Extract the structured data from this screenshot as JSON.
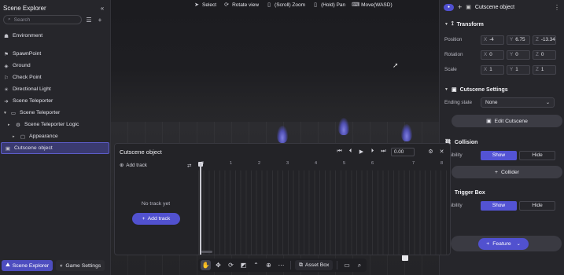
{
  "toolbar_hints": [
    {
      "icon": "cursor-icon",
      "label": "Select"
    },
    {
      "icon": "rotate-icon",
      "label": "Rotate view"
    },
    {
      "icon": "mouse-scroll-icon",
      "label": "(Scroll) Zoom"
    },
    {
      "icon": "mouse-hold-icon",
      "label": "(Hold) Pan"
    },
    {
      "icon": "wasd-icon",
      "label": "Move(WASD)"
    }
  ],
  "scene_explorer": {
    "title": "Scene Explorer",
    "search_placeholder": "Search",
    "items": [
      {
        "label": "Environment",
        "icon": "environment-icon",
        "indent": 0,
        "caret": false
      },
      {
        "label": "SpawnPoint",
        "icon": "spawn-icon",
        "indent": 0,
        "caret": false
      },
      {
        "label": "Ground",
        "icon": "ground-icon",
        "indent": 0,
        "caret": false
      },
      {
        "label": "Check Point",
        "icon": "checkpoint-icon",
        "indent": 0,
        "caret": false
      },
      {
        "label": "Directional Light",
        "icon": "light-icon",
        "indent": 0,
        "caret": false
      },
      {
        "label": "Scene Teleporter",
        "icon": "teleporter-icon",
        "indent": 0,
        "caret": false
      },
      {
        "label": "Scene Teleporter",
        "icon": "folder-icon",
        "indent": 0,
        "caret": true
      },
      {
        "label": "Scene Teleporter Logic",
        "icon": "logic-icon",
        "indent": 1,
        "caret": true
      },
      {
        "label": "Appearance",
        "icon": "appearance-icon",
        "indent": 2,
        "caret": true
      },
      {
        "label": "Cutscene object",
        "icon": "cutscene-icon",
        "indent": 0,
        "caret": false,
        "selected": true
      }
    ]
  },
  "bottom_left": {
    "scene_explorer_label": "Scene Explorer",
    "game_settings_label": "Game Settings"
  },
  "bottom_toolbar": {
    "asset_box_label": "Asset Box"
  },
  "inspector": {
    "object_name": "Cutscene object",
    "transform": {
      "title": "Transform",
      "position_label": "Position",
      "rotation_label": "Rotation",
      "scale_label": "Scale",
      "position": {
        "x": "-4",
        "y": "6.75",
        "z": "-13.34"
      },
      "rotation": {
        "x": "0",
        "y": "0",
        "z": "0"
      },
      "scale": {
        "x": "1",
        "y": "1",
        "z": "1"
      }
    },
    "cutscene_settings": {
      "title": "Cutscene Settings",
      "ending_state_label": "Ending state",
      "ending_state_value": "None",
      "edit_button": "Edit Cutscene"
    },
    "collision": {
      "title": "Collision",
      "visibility_label": "Visibility",
      "show": "Show",
      "hide": "Hide",
      "add_button": "Collider"
    },
    "trigger_box": {
      "title": "Trigger Box",
      "visibility_label": "Visibility",
      "show": "Show",
      "hide": "Hide"
    },
    "feature_button": "Feature"
  },
  "timeline": {
    "title": "Cutscene object",
    "time_value": "0.00",
    "add_track_link": "Add track",
    "empty_text": "No track yet",
    "add_track_button": "Add track",
    "ticks": [
      "0",
      "1",
      "2",
      "3",
      "4",
      "5",
      "6",
      "7",
      "8"
    ]
  },
  "colors": {
    "accent": "#5151cf",
    "panel": "#26262b"
  }
}
